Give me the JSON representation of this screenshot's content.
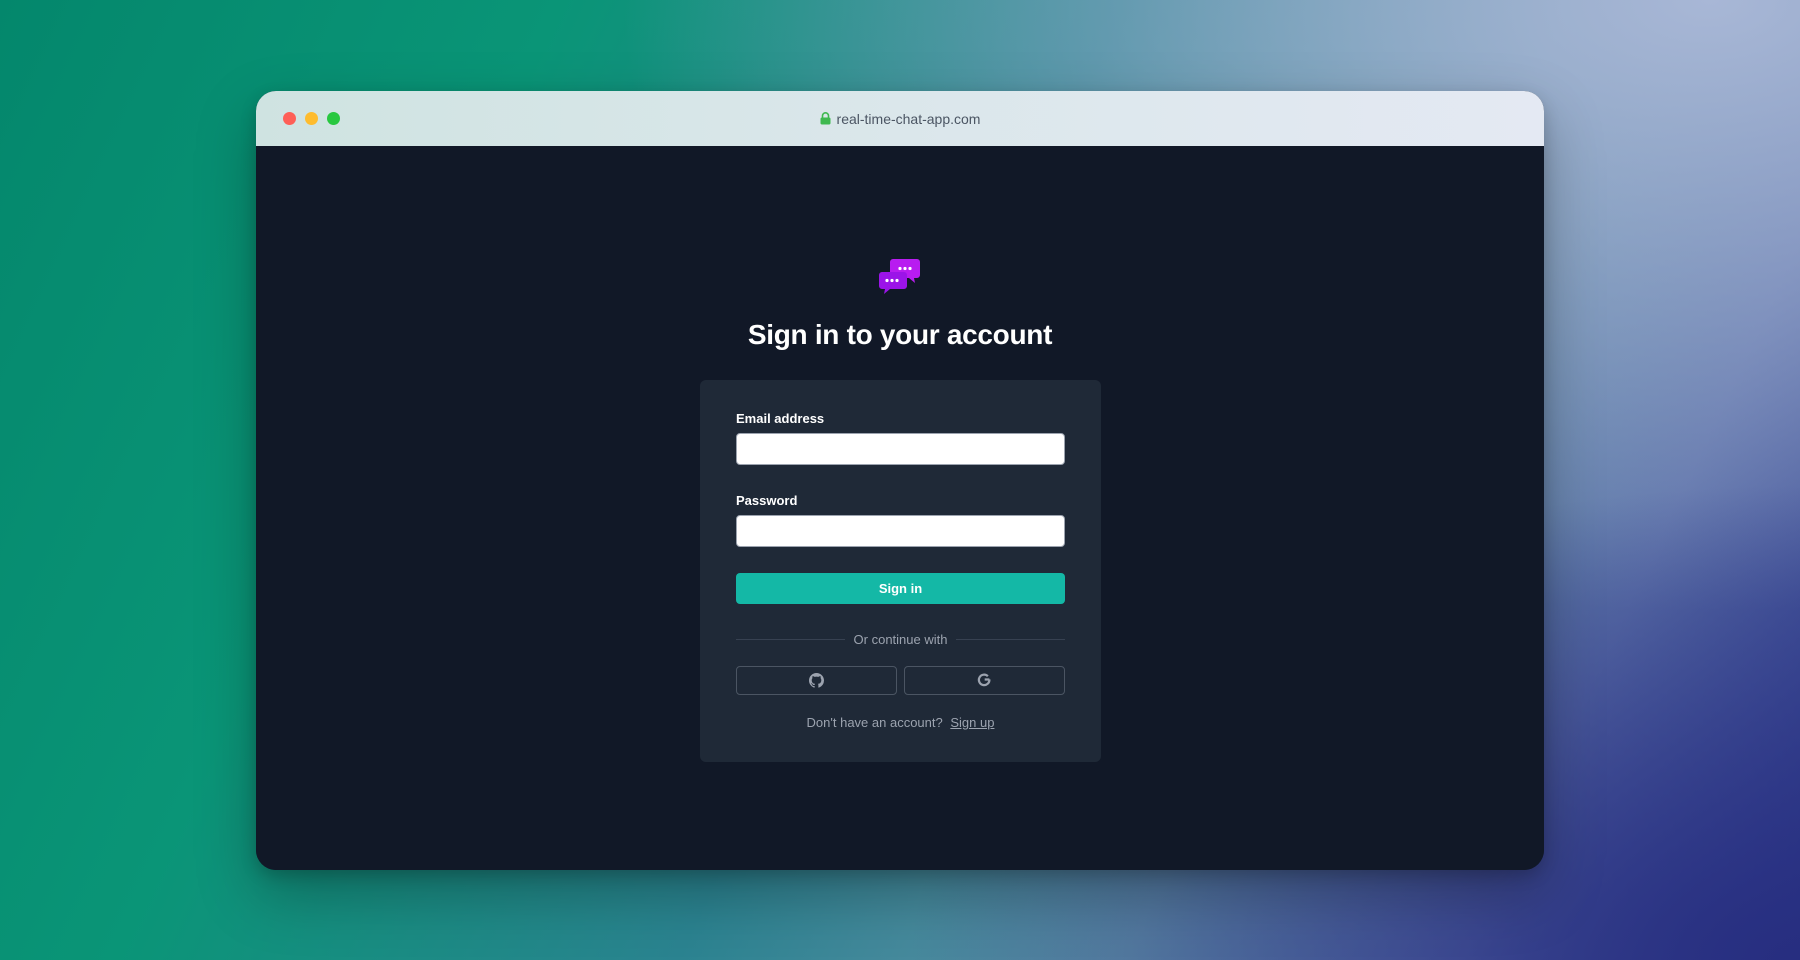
{
  "browser": {
    "url": "real-time-chat-app.com",
    "lock_icon": "lock-icon"
  },
  "page": {
    "logo_icon": "chat-bubbles-icon",
    "heading": "Sign in to your account"
  },
  "form": {
    "email_label": "Email address",
    "email_value": "",
    "password_label": "Password",
    "password_value": "",
    "submit_label": "Sign in",
    "divider_text": "Or continue with",
    "social": [
      {
        "name": "GitHub",
        "icon": "github-icon"
      },
      {
        "name": "Google",
        "icon": "google-icon"
      }
    ]
  },
  "footer": {
    "prompt": "Don't have an account?",
    "link_label": "Sign up"
  },
  "colors": {
    "accent": "#14b8a6",
    "logo": "#a020f0",
    "background": "#111827",
    "card": "#1f2937"
  }
}
